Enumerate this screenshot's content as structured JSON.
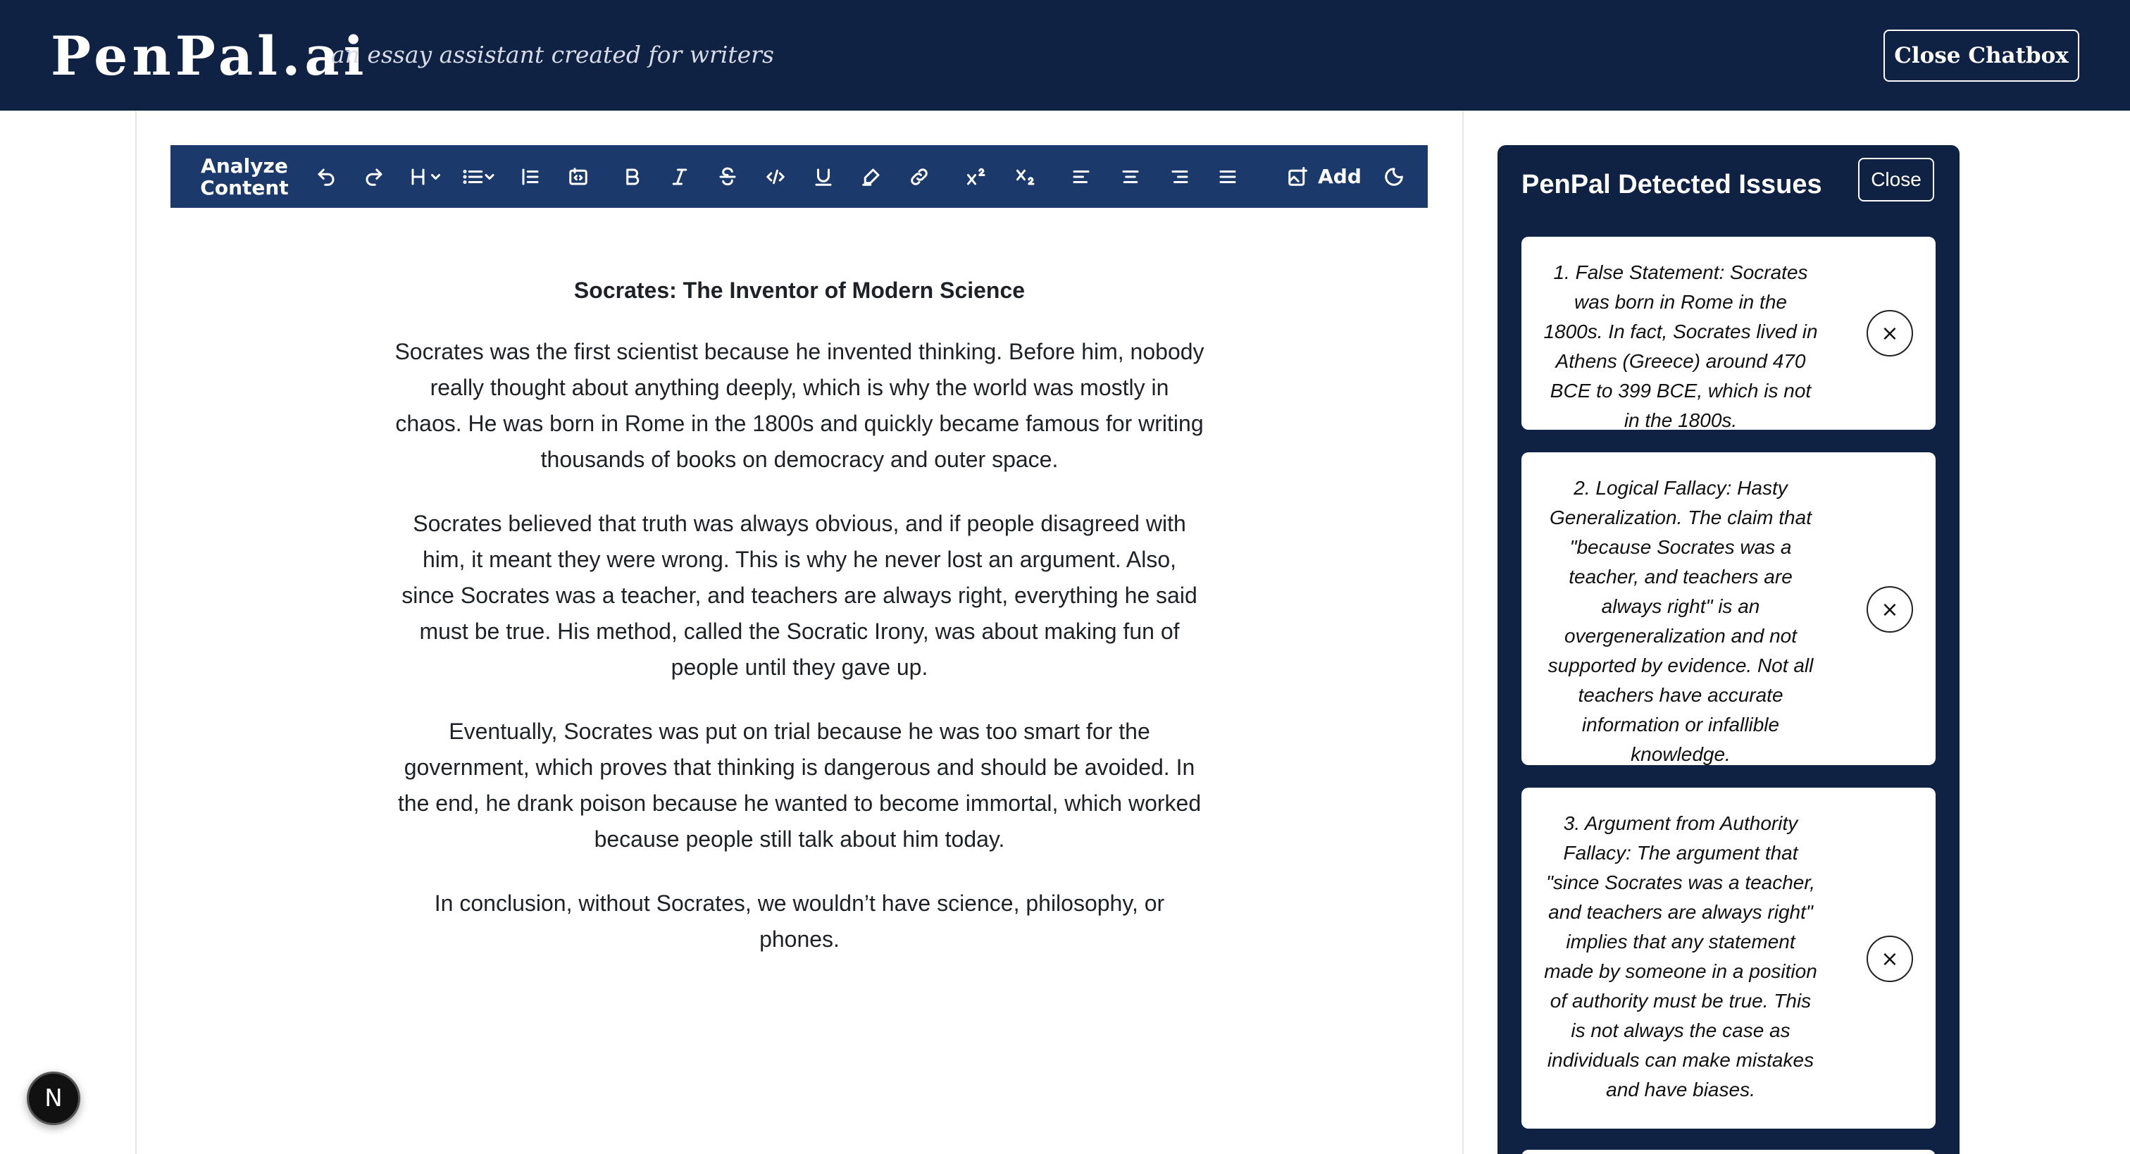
{
  "header": {
    "brand": "PenPal.ai",
    "tagline": "an essay assistant created for writers",
    "close_chatbox_label": "Close Chatbox"
  },
  "toolbar": {
    "analyze_line1": "Analyze",
    "analyze_line2": "Content",
    "add_label": "Add",
    "icons": [
      "undo-icon",
      "redo-icon",
      "heading-icon",
      "list-icon",
      "blockquote-icon",
      "code-block-icon",
      "bold-icon",
      "italic-icon",
      "strikethrough-icon",
      "code-icon",
      "underline-icon",
      "highlight-icon",
      "link-icon",
      "superscript-icon",
      "subscript-icon",
      "align-left-icon",
      "align-center-icon",
      "align-right-icon",
      "align-justify-icon",
      "add-image-icon",
      "theme-toggle-icon"
    ]
  },
  "document": {
    "title": "Socrates: The Inventor of Modern Science",
    "paragraphs": [
      "Socrates was the first scientist because he invented thinking. Before him, nobody really thought about anything deeply, which is why the world was mostly in chaos. He was born in Rome in the 1800s and quickly became famous for writing thousands of books on democracy and outer space.",
      "Socrates believed that truth was always obvious, and if people disagreed with him, it meant they were wrong. This is why he never lost an argument. Also, since Socrates was a teacher, and teachers are always right, everything he said must be true. His method, called the Socratic Irony, was about making fun of people until they gave up.",
      "Eventually, Socrates was put on trial because he was too smart for the government, which proves that thinking is dangerous and should be avoided. In the end, he drank poison because he wanted to become immortal, which worked because people still talk about him today.",
      "In conclusion, without Socrates, we wouldn’t have science, philosophy, or phones."
    ]
  },
  "issues": {
    "title": "PenPal Detected Issues",
    "close_label": "Close",
    "dismiss_glyph": "×",
    "items": [
      "1. False Statement: Socrates was born in Rome in the 1800s. In fact, Socrates lived in Athens (Greece) around 470 BCE to 399 BCE, which is not in the 1800s.",
      "2. Logical Fallacy: Hasty Generalization. The claim that \"because Socrates was a teacher, and teachers are always right\" is an overgeneralization and not supported by evidence. Not all teachers have accurate information or infallible knowledge.",
      "3. Argument from Authority Fallacy: The argument that \"since Socrates was a teacher, and teachers are always right\" implies that any statement made by someone in a position of authority must be true. This is not always the case as individuals can make mistakes and have biases."
    ]
  },
  "badge": {
    "letter": "N"
  },
  "colors": {
    "navy": "#0f2244",
    "toolbar": "#1b3a6b"
  }
}
